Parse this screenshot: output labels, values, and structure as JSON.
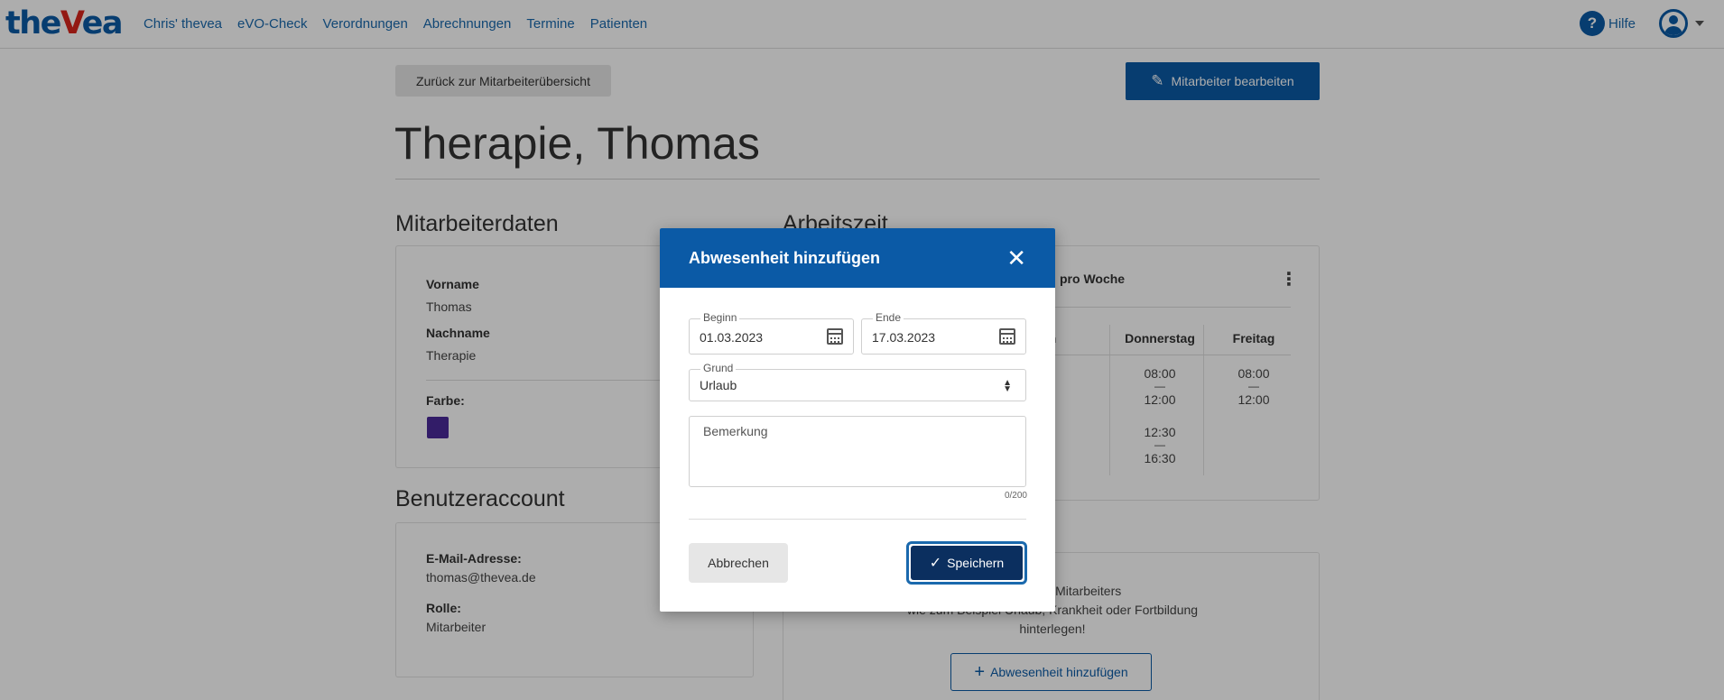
{
  "nav": {
    "logo_the": "the",
    "logo_v": "V",
    "logo_ea": "ea",
    "links": [
      "Chris' thevea",
      "eVO-Check",
      "Verordnungen",
      "Abrechnungen",
      "Termine",
      "Patienten"
    ],
    "help_label": "Hilfe",
    "help_glyph": "?"
  },
  "page": {
    "back_button": "Zurück zur Mitarbeiterübersicht",
    "edit_button": "Mitarbeiter bearbeiten",
    "title": "Therapie, Thomas"
  },
  "employee_data": {
    "heading": "Mitarbeiterdaten",
    "first_name_label": "Vorname",
    "first_name": "Thomas",
    "last_name_label": "Nachname",
    "last_name": "Therapie",
    "color_label": "Farbe:",
    "color": "#4a2a9a"
  },
  "account": {
    "heading": "Benutzeraccount",
    "email_label": "E-Mail-Adresse:",
    "email": "thomas@thevea.de",
    "role_label": "Rolle:",
    "role": "Mitarbeiter"
  },
  "worktime": {
    "heading": "Arbeitszeit",
    "week_title": "pro Woche",
    "days": [
      "roch",
      "Donnerstag",
      "Freitag"
    ],
    "partial_times": [
      "00",
      "00",
      "30",
      "30"
    ],
    "donnerstag": [
      "08:00",
      "12:00",
      "12:30",
      "16:30"
    ],
    "freitag": [
      "08:00",
      "12:00"
    ],
    "dash": "—"
  },
  "absence_info": {
    "line1": "eiten deines Mitarbeiters",
    "line2": "wie zum Beispiel Urlaub, Krankheit oder Fortbildung",
    "line3": "hinterlegen!",
    "button": "Abwesenheit hinzufügen"
  },
  "modal": {
    "title": "Abwesenheit hinzufügen",
    "close_glyph": "✕",
    "begin_label": "Beginn",
    "begin_value": "01.03.2023",
    "end_label": "Ende",
    "end_value": "17.03.2023",
    "reason_label": "Grund",
    "reason_value": "Urlaub",
    "remark_placeholder": "Bemerkung",
    "counter": "0/200",
    "cancel_button": "Abbrechen",
    "save_button": "Speichern"
  },
  "icons": {
    "edit": "pencil-icon",
    "calendar": "calendar-icon",
    "close": "close-icon",
    "check": "check-icon",
    "plus": "plus-icon",
    "kebab": "more-vertical-icon",
    "select": "select-arrows-icon",
    "help": "help-icon",
    "avatar": "user-avatar-icon"
  },
  "colors": {
    "primary": "#0b5aa6",
    "save_dark": "#0b2f5f",
    "logo_accent": "#d9261c"
  }
}
